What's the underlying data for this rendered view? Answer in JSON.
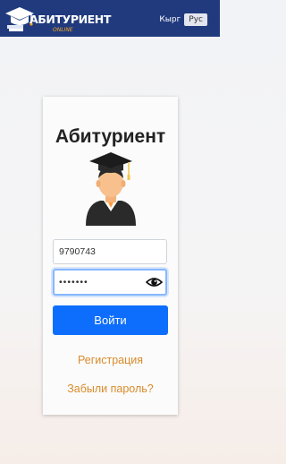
{
  "header": {
    "logo_text": "АБИТУРИЕНТ",
    "logo_sub": "ONLINE",
    "lang_ky": "Кырг",
    "lang_ru": "Рус",
    "accent_color": "#203a7d"
  },
  "login": {
    "title": "Абитуриент",
    "avatar_icon": "graduate-avatar-icon",
    "login_value": "9790743",
    "password_value": "•••••••",
    "eye_icon": "eye-icon",
    "submit_label": "Войти",
    "register_link": "Регистрация",
    "forgot_link": "Забыли пароль?",
    "button_color": "#0d6efd",
    "link_color": "#d98b2b"
  }
}
